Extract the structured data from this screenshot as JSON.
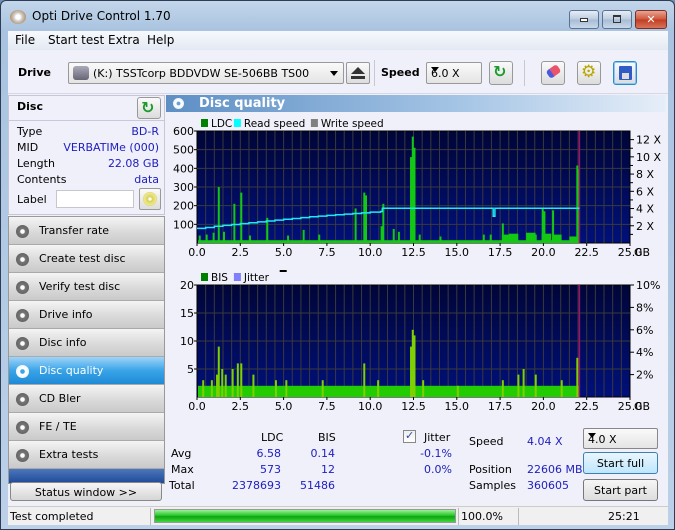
{
  "window": {
    "title": "Opti Drive Control 1.70",
    "controls": {
      "minimize": "minimize",
      "maximize": "maximize",
      "close": "close"
    }
  },
  "menu": [
    {
      "label": "File",
      "key": "F"
    },
    {
      "label": "Start test",
      "key": "S"
    },
    {
      "label": "Extra",
      "key": "x"
    },
    {
      "label": "Help",
      "key": "H"
    }
  ],
  "toolbar": {
    "drive_label": "Drive",
    "drive_value": "(K:)  TSSTcorp BDDVDW SE-506BB TS00",
    "speed_label": "Speed",
    "speed_value": "6.0 X",
    "icons": [
      "eject-icon",
      "refresh-icon",
      "erase-icon",
      "settings-icon",
      "save-icon"
    ]
  },
  "disc": {
    "header": "Disc",
    "fields": [
      {
        "key": "Type",
        "value": "BD-R"
      },
      {
        "key": "MID",
        "value": "VERBATIMe (000)"
      },
      {
        "key": "Length",
        "value": "22.08 GB"
      },
      {
        "key": "Contents",
        "value": "data"
      }
    ],
    "label_key": "Label",
    "label_value": ""
  },
  "nav": {
    "items": [
      {
        "label": "Transfer rate",
        "active": false
      },
      {
        "label": "Create test disc",
        "active": false
      },
      {
        "label": "Verify test disc",
        "active": false
      },
      {
        "label": "Drive info",
        "active": false
      },
      {
        "label": "Disc info",
        "active": false
      },
      {
        "label": "Disc quality",
        "active": true
      },
      {
        "label": "CD Bler",
        "active": false
      },
      {
        "label": "FE / TE",
        "active": false
      },
      {
        "label": "Extra tests",
        "active": false
      }
    ],
    "status_window_button": "Status window >>"
  },
  "main": {
    "title": "Disc quality"
  },
  "chart_data": [
    {
      "type": "bar",
      "title": "LDC / Read speed",
      "legend": [
        {
          "name": "LDC",
          "color": "#008000"
        },
        {
          "name": "Read speed",
          "color": "#00ffff"
        },
        {
          "name": "Write speed",
          "color": "#808080"
        }
      ],
      "xlabel": "GB",
      "xlim": [
        0,
        25
      ],
      "xticks": [
        "0.0",
        "2.5",
        "5.0",
        "7.5",
        "10.0",
        "12.5",
        "15.0",
        "17.5",
        "20.0",
        "22.5",
        "25.0"
      ],
      "ylim": [
        0,
        600
      ],
      "yticks": [
        "100",
        "200",
        "300",
        "400",
        "500",
        "600"
      ],
      "y2lim": [
        0,
        13
      ],
      "y2ticks": [
        "2 X",
        "4 X",
        "6 X",
        "8 X",
        "10 X",
        "12 X"
      ],
      "grid": true,
      "end_marker_gb": 22.08,
      "ldc_baseline": 15,
      "ldc_spikes": [
        [
          0.1,
          40
        ],
        [
          0.5,
          45
        ],
        [
          0.9,
          55
        ],
        [
          1.2,
          300
        ],
        [
          1.5,
          60
        ],
        [
          2.1,
          210
        ],
        [
          2.5,
          270
        ],
        [
          3.0,
          40
        ],
        [
          4.0,
          135
        ],
        [
          5.2,
          40
        ],
        [
          6.1,
          70
        ],
        [
          7.0,
          45
        ],
        [
          9.1,
          185
        ],
        [
          9.6,
          270
        ],
        [
          9.7,
          255
        ],
        [
          10.6,
          90
        ],
        [
          10.7,
          210
        ],
        [
          11.3,
          75
        ],
        [
          11.6,
          60
        ],
        [
          12.3,
          460
        ],
        [
          12.4,
          570
        ],
        [
          12.5,
          510
        ],
        [
          12.8,
          45
        ],
        [
          14.0,
          35
        ],
        [
          16.5,
          45
        ],
        [
          16.9,
          45
        ],
        [
          17.6,
          105
        ],
        [
          19.5,
          45
        ],
        [
          19.9,
          185
        ],
        [
          20.0,
          170
        ],
        [
          20.5,
          175
        ],
        [
          21.9,
          415
        ],
        [
          22.0,
          395
        ]
      ],
      "ldc_hump": [
        [
          17.6,
          45
        ],
        [
          18.0,
          50
        ],
        [
          19.0,
          55
        ],
        [
          19.9,
          50
        ],
        [
          20.5,
          45
        ],
        [
          21.5,
          35
        ]
      ],
      "read_speed": [
        [
          0,
          1.7
        ],
        [
          0.5,
          1.8
        ],
        [
          1,
          1.95
        ],
        [
          1.5,
          2.05
        ],
        [
          2,
          2.15
        ],
        [
          2.5,
          2.25
        ],
        [
          3,
          2.35
        ],
        [
          3.5,
          2.45
        ],
        [
          4,
          2.55
        ],
        [
          4.5,
          2.65
        ],
        [
          5,
          2.75
        ],
        [
          5.5,
          2.85
        ],
        [
          6,
          2.95
        ],
        [
          6.5,
          3.05
        ],
        [
          7,
          3.12
        ],
        [
          7.5,
          3.2
        ],
        [
          8,
          3.28
        ],
        [
          8.5,
          3.35
        ],
        [
          9,
          3.43
        ],
        [
          9.5,
          3.5
        ],
        [
          10,
          3.58
        ],
        [
          10.6,
          3.65
        ],
        [
          10.7,
          4.04
        ],
        [
          17.0,
          4.04
        ],
        [
          17.1,
          3.1
        ],
        [
          17.2,
          4.04
        ],
        [
          22.08,
          4.04
        ]
      ]
    },
    {
      "type": "bar",
      "title": "BIS / Jitter",
      "legend": [
        {
          "name": "BIS",
          "color": "#008000"
        },
        {
          "name": "Jitter",
          "color": "#8080ff"
        }
      ],
      "xlabel": "GB",
      "xlim": [
        0,
        25
      ],
      "xticks": [
        "0.0",
        "2.5",
        "5.0",
        "7.5",
        "10.0",
        "12.5",
        "15.0",
        "17.5",
        "20.0",
        "22.5",
        "25.0"
      ],
      "ylim": [
        0,
        20
      ],
      "yticks": [
        "5",
        "10",
        "15",
        "20"
      ],
      "y2lim": [
        0,
        10
      ],
      "y2ticks": [
        "2%",
        "4%",
        "6%",
        "8%",
        "10%"
      ],
      "grid": true,
      "end_marker_gb": 22.08,
      "bis_baseline": 2,
      "bis_spikes": [
        [
          0.3,
          3
        ],
        [
          0.8,
          3
        ],
        [
          1.1,
          4
        ],
        [
          1.2,
          9
        ],
        [
          1.4,
          5
        ],
        [
          1.6,
          4
        ],
        [
          2.0,
          5
        ],
        [
          2.3,
          6
        ],
        [
          2.5,
          6
        ],
        [
          3.2,
          4
        ],
        [
          4.5,
          3
        ],
        [
          5.1,
          3
        ],
        [
          7.2,
          3
        ],
        [
          9.6,
          6
        ],
        [
          10.4,
          3
        ],
        [
          12.3,
          9
        ],
        [
          12.4,
          12
        ],
        [
          12.5,
          11
        ],
        [
          13.0,
          3
        ],
        [
          15.0,
          2
        ],
        [
          17.6,
          3
        ],
        [
          18.5,
          4
        ],
        [
          18.8,
          5
        ],
        [
          19.5,
          4
        ],
        [
          21.0,
          3
        ],
        [
          21.9,
          7
        ]
      ],
      "jitter_pct": 0
    }
  ],
  "stats": {
    "cols": [
      "LDC",
      "BIS"
    ],
    "rows": [
      {
        "label": "Avg",
        "ldc": "6.58",
        "bis": "0.14",
        "jitter": "-0.1%"
      },
      {
        "label": "Max",
        "ldc": "573",
        "bis": "12",
        "jitter": "0.0%"
      },
      {
        "label": "Total",
        "ldc": "2378693",
        "bis": "51486",
        "jitter": ""
      }
    ],
    "jitter_label": "Jitter",
    "jitter_checked": true,
    "speed_label": "Speed",
    "speed_value": "4.04 X",
    "position_label": "Position",
    "position_value": "22606 MB",
    "samples_label": "Samples",
    "samples_value": "360605",
    "test_speed": "4.0 X",
    "start_full": "Start full",
    "start_part": "Start part"
  },
  "status": {
    "text": "Test completed",
    "progress_pct": 100,
    "progress_label": "100.0%",
    "elapsed": "25:21"
  }
}
